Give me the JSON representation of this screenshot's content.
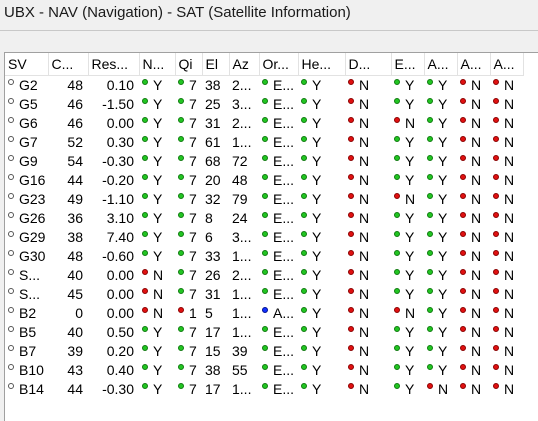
{
  "window": {
    "title": "UBX - NAV (Navigation) - SAT (Satellite Information)"
  },
  "colors": {
    "green": "#22c522",
    "red": "#e01010",
    "blue": "#1030ff",
    "white": "#ffffff"
  },
  "table": {
    "headers": [
      "SV",
      "C...",
      "Res...",
      "N...",
      "Qi",
      "El",
      "Az",
      "Or...",
      "He...",
      "D...",
      "E...",
      "A...",
      "A...",
      "A..."
    ],
    "rows": [
      {
        "sv": "G2",
        "cno": "48",
        "res": "0.10",
        "n": "Y",
        "qi": "7",
        "el": "38",
        "az": "2...",
        "or": "E...",
        "he": "Y",
        "d": "N",
        "e": "Y",
        "a1": "Y",
        "a2": "N",
        "a3": "N",
        "dots": {
          "n": "g",
          "qi": "g",
          "or": "g",
          "he": "g",
          "d": "r",
          "e": "g",
          "a1": "g",
          "a2": "r",
          "a3": "r"
        }
      },
      {
        "sv": "G5",
        "cno": "46",
        "res": "-1.50",
        "n": "Y",
        "qi": "7",
        "el": "25",
        "az": "3...",
        "or": "E...",
        "he": "Y",
        "d": "N",
        "e": "Y",
        "a1": "Y",
        "a2": "N",
        "a3": "N",
        "dots": {
          "n": "g",
          "qi": "g",
          "or": "g",
          "he": "g",
          "d": "r",
          "e": "g",
          "a1": "g",
          "a2": "r",
          "a3": "r"
        }
      },
      {
        "sv": "G6",
        "cno": "46",
        "res": "0.00",
        "n": "Y",
        "qi": "7",
        "el": "31",
        "az": "2...",
        "or": "E...",
        "he": "Y",
        "d": "N",
        "e": "N",
        "a1": "Y",
        "a2": "N",
        "a3": "N",
        "dots": {
          "n": "g",
          "qi": "g",
          "or": "g",
          "he": "g",
          "d": "r",
          "e": "r",
          "a1": "g",
          "a2": "r",
          "a3": "r"
        }
      },
      {
        "sv": "G7",
        "cno": "52",
        "res": "0.30",
        "n": "Y",
        "qi": "7",
        "el": "61",
        "az": "1...",
        "or": "E...",
        "he": "Y",
        "d": "N",
        "e": "Y",
        "a1": "Y",
        "a2": "N",
        "a3": "N",
        "dots": {
          "n": "g",
          "qi": "g",
          "or": "g",
          "he": "g",
          "d": "r",
          "e": "g",
          "a1": "g",
          "a2": "r",
          "a3": "r"
        }
      },
      {
        "sv": "G9",
        "cno": "54",
        "res": "-0.30",
        "n": "Y",
        "qi": "7",
        "el": "68",
        "az": "72",
        "or": "E...",
        "he": "Y",
        "d": "N",
        "e": "Y",
        "a1": "Y",
        "a2": "N",
        "a3": "N",
        "dots": {
          "n": "g",
          "qi": "g",
          "or": "g",
          "he": "g",
          "d": "r",
          "e": "g",
          "a1": "g",
          "a2": "r",
          "a3": "r"
        }
      },
      {
        "sv": "G16",
        "cno": "44",
        "res": "-0.20",
        "n": "Y",
        "qi": "7",
        "el": "20",
        "az": "48",
        "or": "E...",
        "he": "Y",
        "d": "N",
        "e": "Y",
        "a1": "Y",
        "a2": "N",
        "a3": "N",
        "dots": {
          "n": "g",
          "qi": "g",
          "or": "g",
          "he": "g",
          "d": "r",
          "e": "g",
          "a1": "g",
          "a2": "r",
          "a3": "r"
        }
      },
      {
        "sv": "G23",
        "cno": "49",
        "res": "-1.10",
        "n": "Y",
        "qi": "7",
        "el": "32",
        "az": "79",
        "or": "E...",
        "he": "Y",
        "d": "N",
        "e": "N",
        "a1": "Y",
        "a2": "N",
        "a3": "N",
        "dots": {
          "n": "g",
          "qi": "g",
          "or": "g",
          "he": "g",
          "d": "r",
          "e": "r",
          "a1": "g",
          "a2": "r",
          "a3": "r"
        }
      },
      {
        "sv": "G26",
        "cno": "36",
        "res": "3.10",
        "n": "Y",
        "qi": "7",
        "el": "8",
        "az": "24",
        "or": "E...",
        "he": "Y",
        "d": "N",
        "e": "Y",
        "a1": "Y",
        "a2": "N",
        "a3": "N",
        "dots": {
          "n": "g",
          "qi": "g",
          "or": "g",
          "he": "g",
          "d": "r",
          "e": "g",
          "a1": "g",
          "a2": "r",
          "a3": "r"
        }
      },
      {
        "sv": "G29",
        "cno": "38",
        "res": "7.40",
        "n": "Y",
        "qi": "7",
        "el": "6",
        "az": "3...",
        "or": "E...",
        "he": "Y",
        "d": "N",
        "e": "Y",
        "a1": "Y",
        "a2": "N",
        "a3": "N",
        "dots": {
          "n": "g",
          "qi": "g",
          "or": "g",
          "he": "g",
          "d": "r",
          "e": "g",
          "a1": "g",
          "a2": "r",
          "a3": "r"
        }
      },
      {
        "sv": "G30",
        "cno": "48",
        "res": "-0.60",
        "n": "Y",
        "qi": "7",
        "el": "33",
        "az": "1...",
        "or": "E...",
        "he": "Y",
        "d": "N",
        "e": "Y",
        "a1": "Y",
        "a2": "N",
        "a3": "N",
        "dots": {
          "n": "g",
          "qi": "g",
          "or": "g",
          "he": "g",
          "d": "r",
          "e": "g",
          "a1": "g",
          "a2": "r",
          "a3": "r"
        }
      },
      {
        "sv": "S...",
        "cno": "40",
        "res": "0.00",
        "n": "N",
        "qi": "7",
        "el": "26",
        "az": "2...",
        "or": "E...",
        "he": "Y",
        "d": "N",
        "e": "Y",
        "a1": "Y",
        "a2": "N",
        "a3": "N",
        "dots": {
          "n": "r",
          "qi": "g",
          "or": "g",
          "he": "g",
          "d": "r",
          "e": "g",
          "a1": "g",
          "a2": "r",
          "a3": "r"
        }
      },
      {
        "sv": "S...",
        "cno": "45",
        "res": "0.00",
        "n": "N",
        "qi": "7",
        "el": "31",
        "az": "1...",
        "or": "E...",
        "he": "Y",
        "d": "N",
        "e": "Y",
        "a1": "Y",
        "a2": "N",
        "a3": "N",
        "dots": {
          "n": "r",
          "qi": "g",
          "or": "g",
          "he": "g",
          "d": "r",
          "e": "g",
          "a1": "g",
          "a2": "r",
          "a3": "r"
        }
      },
      {
        "sv": "B2",
        "cno": "0",
        "res": "0.00",
        "n": "N",
        "qi": "1",
        "el": "5",
        "az": "1...",
        "or": "A...",
        "he": "Y",
        "d": "N",
        "e": "N",
        "a1": "Y",
        "a2": "N",
        "a3": "N",
        "dots": {
          "n": "r",
          "qi": "r",
          "or": "b",
          "he": "g",
          "d": "r",
          "e": "r",
          "a1": "g",
          "a2": "r",
          "a3": "r"
        }
      },
      {
        "sv": "B5",
        "cno": "40",
        "res": "0.50",
        "n": "Y",
        "qi": "7",
        "el": "17",
        "az": "1...",
        "or": "E...",
        "he": "Y",
        "d": "N",
        "e": "Y",
        "a1": "Y",
        "a2": "N",
        "a3": "N",
        "dots": {
          "n": "g",
          "qi": "g",
          "or": "g",
          "he": "g",
          "d": "r",
          "e": "g",
          "a1": "g",
          "a2": "r",
          "a3": "r"
        }
      },
      {
        "sv": "B7",
        "cno": "39",
        "res": "0.20",
        "n": "Y",
        "qi": "7",
        "el": "15",
        "az": "39",
        "or": "E...",
        "he": "Y",
        "d": "N",
        "e": "Y",
        "a1": "Y",
        "a2": "N",
        "a3": "N",
        "dots": {
          "n": "g",
          "qi": "g",
          "or": "g",
          "he": "g",
          "d": "r",
          "e": "g",
          "a1": "g",
          "a2": "r",
          "a3": "r"
        }
      },
      {
        "sv": "B10",
        "cno": "43",
        "res": "0.40",
        "n": "Y",
        "qi": "7",
        "el": "38",
        "az": "55",
        "or": "E...",
        "he": "Y",
        "d": "N",
        "e": "Y",
        "a1": "Y",
        "a2": "N",
        "a3": "N",
        "dots": {
          "n": "g",
          "qi": "g",
          "or": "g",
          "he": "g",
          "d": "r",
          "e": "g",
          "a1": "g",
          "a2": "r",
          "a3": "r"
        }
      },
      {
        "sv": "B14",
        "cno": "44",
        "res": "-0.30",
        "n": "Y",
        "qi": "7",
        "el": "17",
        "az": "1...",
        "or": "E...",
        "he": "Y",
        "d": "N",
        "e": "Y",
        "a1": "N",
        "a2": "N",
        "a3": "N",
        "dots": {
          "n": "g",
          "qi": "g",
          "or": "g",
          "he": "g",
          "d": "r",
          "e": "g",
          "a1": "r",
          "a2": "r",
          "a3": "r"
        }
      }
    ]
  }
}
